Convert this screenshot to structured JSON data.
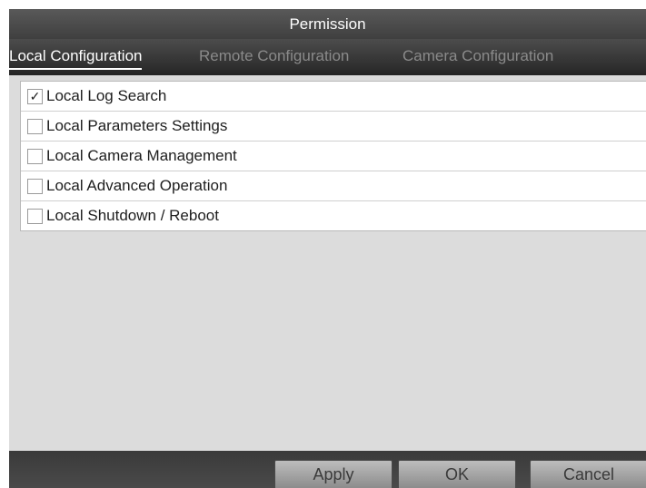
{
  "dialog": {
    "title": "Permission"
  },
  "tabs": [
    {
      "label": "Local Configuration",
      "active": true
    },
    {
      "label": "Remote Configuration",
      "active": false
    },
    {
      "label": "Camera Configuration",
      "active": false
    }
  ],
  "permissions": [
    {
      "label": "Local Log Search",
      "checked": true,
      "mark": "✓"
    },
    {
      "label": "Local Parameters Settings",
      "checked": false,
      "mark": ""
    },
    {
      "label": "Local Camera Management",
      "checked": false,
      "mark": ""
    },
    {
      "label": "Local Advanced Operation",
      "checked": false,
      "mark": ""
    },
    {
      "label": "Local Shutdown / Reboot",
      "checked": false,
      "mark": ""
    }
  ],
  "buttons": {
    "apply": "Apply",
    "ok": "OK",
    "cancel": "Cancel"
  }
}
